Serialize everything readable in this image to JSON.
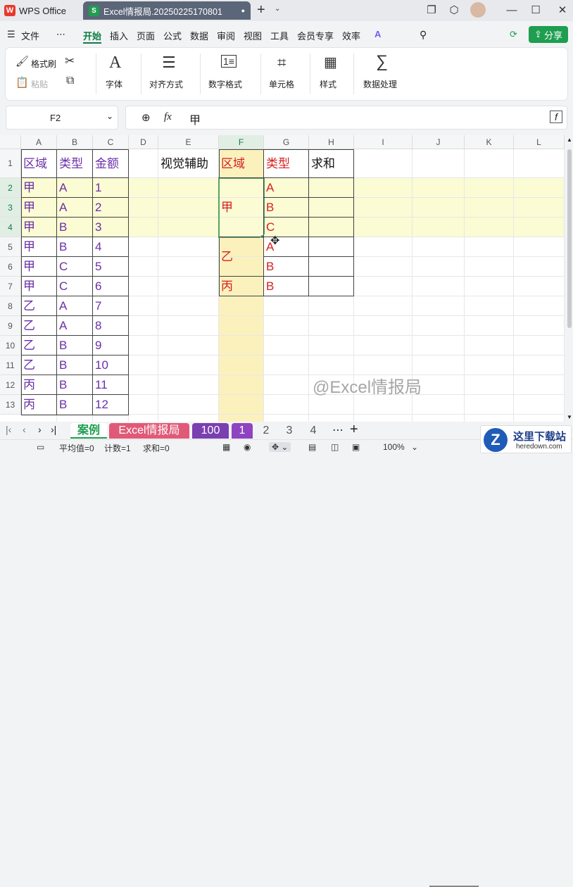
{
  "titlebar": {
    "home_tab": "WPS Office",
    "doc_tab": "Excel情报局.20250225170801",
    "close_dot": "●",
    "add_tab": "+"
  },
  "menu": {
    "file": "文件",
    "more": "⋯",
    "items": [
      "开始",
      "插入",
      "页面",
      "公式",
      "数据",
      "审阅",
      "视图",
      "工具",
      "会员专享",
      "效率"
    ],
    "active": "开始",
    "share": "分享"
  },
  "ribbon": {
    "format_painter": "格式刷",
    "paste": "粘贴",
    "font": "字体",
    "align": "对齐方式",
    "number_format": "数字格式",
    "cell": "单元格",
    "style": "样式",
    "data_process": "数据处理"
  },
  "formula_bar": {
    "name_box": "F2",
    "fx": "fx",
    "content": "甲"
  },
  "columns": [
    "A",
    "B",
    "C",
    "D",
    "E",
    "F",
    "G",
    "H",
    "I",
    "J",
    "K",
    "L"
  ],
  "rows": [
    "1",
    "2",
    "3",
    "4",
    "5",
    "6",
    "7",
    "8",
    "9",
    "10",
    "11",
    "12",
    "13"
  ],
  "selected_cell": "F2",
  "cells": {
    "A": [
      "区域",
      "甲",
      "甲",
      "甲",
      "甲",
      "甲",
      "甲",
      "乙",
      "乙",
      "乙",
      "乙",
      "丙",
      "丙"
    ],
    "B": [
      "类型",
      "A",
      "A",
      "B",
      "B",
      "C",
      "C",
      "A",
      "A",
      "B",
      "B",
      "B",
      "B"
    ],
    "C": [
      "金额",
      "1",
      "2",
      "3",
      "4",
      "5",
      "6",
      "7",
      "8",
      "9",
      "10",
      "11",
      "12"
    ],
    "E1": "视觉辅助",
    "F1": "区域",
    "G1": "类型",
    "H1": "求和",
    "F_merged": [
      "甲",
      "乙",
      "丙"
    ],
    "G": [
      "A",
      "B",
      "C",
      "A",
      "B",
      "B"
    ]
  },
  "watermark": "@Excel情报局",
  "sheets": {
    "tabs": [
      {
        "label": "案例",
        "color": "#1e9e50"
      },
      {
        "label": "Excel情报局",
        "color": "#e05a78"
      },
      {
        "label": "100",
        "color": "#7a3fb0"
      },
      {
        "label": "1",
        "color": "#8e44c0"
      },
      {
        "label": "2",
        "color": ""
      },
      {
        "label": "3",
        "color": ""
      },
      {
        "label": "4",
        "color": ""
      }
    ],
    "more": "⋯",
    "add": "+"
  },
  "status": {
    "average": "平均值=0",
    "count": "计数=1",
    "sum": "求和=0",
    "zoom": "100%"
  },
  "corner_logo": {
    "title": "这里下载站",
    "url": "heredown.com"
  },
  "colors": {
    "accent_green": "#1e9e50",
    "purple_text": "#6a2fa8",
    "red_text": "#d62020",
    "row_highlight": "#fbfbd4",
    "col_highlight": "#fbf1bd"
  }
}
